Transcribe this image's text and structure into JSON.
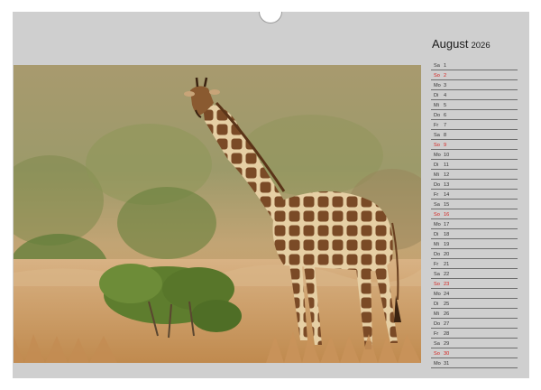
{
  "calendar": {
    "month": "August",
    "year": "2026",
    "sunday_color": "#d6201d",
    "rows": [
      {
        "wd": "Sa",
        "day": "1",
        "sun": false
      },
      {
        "wd": "So",
        "day": "2",
        "sun": true
      },
      {
        "wd": "Mo",
        "day": "3",
        "sun": false
      },
      {
        "wd": "Di",
        "day": "4",
        "sun": false
      },
      {
        "wd": "Mi",
        "day": "5",
        "sun": false
      },
      {
        "wd": "Do",
        "day": "6",
        "sun": false
      },
      {
        "wd": "Fr",
        "day": "7",
        "sun": false
      },
      {
        "wd": "Sa",
        "day": "8",
        "sun": false
      },
      {
        "wd": "So",
        "day": "9",
        "sun": true
      },
      {
        "wd": "Mo",
        "day": "10",
        "sun": false
      },
      {
        "wd": "Di",
        "day": "11",
        "sun": false
      },
      {
        "wd": "Mi",
        "day": "12",
        "sun": false
      },
      {
        "wd": "Do",
        "day": "13",
        "sun": false
      },
      {
        "wd": "Fr",
        "day": "14",
        "sun": false
      },
      {
        "wd": "Sa",
        "day": "15",
        "sun": false
      },
      {
        "wd": "So",
        "day": "16",
        "sun": true
      },
      {
        "wd": "Mo",
        "day": "17",
        "sun": false
      },
      {
        "wd": "Di",
        "day": "18",
        "sun": false
      },
      {
        "wd": "Mi",
        "day": "19",
        "sun": false
      },
      {
        "wd": "Do",
        "day": "20",
        "sun": false
      },
      {
        "wd": "Fr",
        "day": "21",
        "sun": false
      },
      {
        "wd": "Sa",
        "day": "22",
        "sun": false
      },
      {
        "wd": "So",
        "day": "23",
        "sun": true
      },
      {
        "wd": "Mo",
        "day": "24",
        "sun": false
      },
      {
        "wd": "Di",
        "day": "25",
        "sun": false
      },
      {
        "wd": "Mi",
        "day": "26",
        "sun": false
      },
      {
        "wd": "Do",
        "day": "27",
        "sun": false
      },
      {
        "wd": "Fr",
        "day": "28",
        "sun": false
      },
      {
        "wd": "Sa",
        "day": "29",
        "sun": false
      },
      {
        "wd": "So",
        "day": "30",
        "sun": true
      },
      {
        "wd": "Mo",
        "day": "31",
        "sun": false
      }
    ]
  },
  "photo": {
    "subject": "giraffe",
    "colors": {
      "grass": "#c89a5e",
      "bush": "#6a8a3a",
      "giraffe_patch": "#7a4a26",
      "giraffe_line": "#e8d4ae"
    }
  }
}
